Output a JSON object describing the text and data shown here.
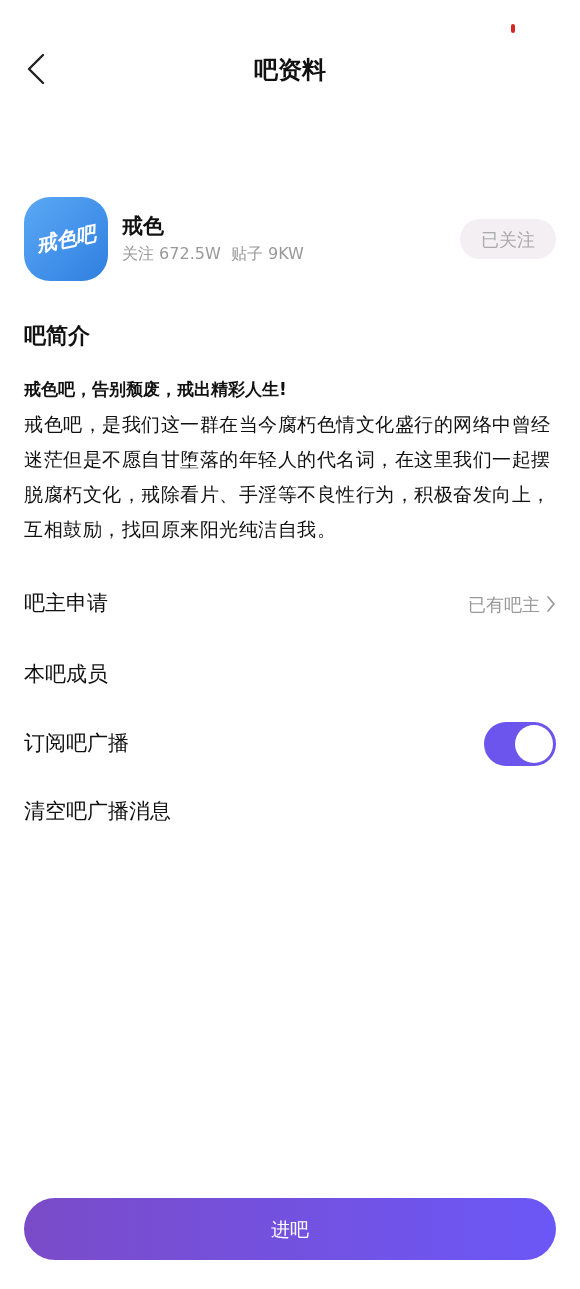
{
  "header": {
    "title": "吧资料"
  },
  "forum": {
    "logo_text": "戒色吧",
    "name": "戒色",
    "stats": "关注 672.5W  贴子 9KW",
    "follow_button": {
      "label": "已关注",
      "followed": true
    }
  },
  "intro": {
    "heading": "吧简介",
    "slogan": "戒色吧，告别颓废，戒出精彩人生!",
    "body": "戒色吧，是我们这一群在当今腐朽色情文化盛行的网络中曾经迷茫但是不愿自甘堕落的年轻人的代名词，在这里我们一起摆脱腐朽文化，戒除看片、手淫等不良性行为，积极奋发向上，互相鼓励，找回原来阳光纯洁自我。"
  },
  "settings": [
    {
      "kind": "link",
      "label": "吧主申请",
      "value": "已有吧主"
    },
    {
      "kind": "plain",
      "label": "本吧成员"
    },
    {
      "kind": "toggle",
      "label": "订阅吧广播",
      "on": true
    },
    {
      "kind": "plain",
      "label": "清空吧广播消息"
    }
  ],
  "enter_button": {
    "label": "进吧"
  }
}
